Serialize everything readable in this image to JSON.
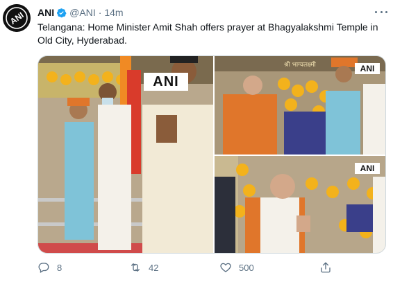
{
  "tweet": {
    "author_name": "ANI",
    "handle": "@ANI",
    "separator": "·",
    "time": "14m",
    "text": "Telangana: Home Minister Amit Shah offers prayer at Bhagyalakshmi Temple in Old City, Hyderabad.",
    "avatar_text": "ANI",
    "watermark": "ANI",
    "temple_signboard": "श्री भाग्यलक्ष्मी"
  },
  "actions": {
    "reply_count": "8",
    "retweet_count": "42",
    "like_count": "500"
  },
  "icons": {
    "verified": "verified-badge-icon",
    "more": "more-options-icon",
    "reply": "reply-icon",
    "retweet": "retweet-icon",
    "like": "heart-icon",
    "share": "share-icon"
  },
  "colors": {
    "verified": "#1da1f2",
    "muted": "#5b7083",
    "saffron": "#e0762b",
    "marigold": "#f3b21c"
  }
}
